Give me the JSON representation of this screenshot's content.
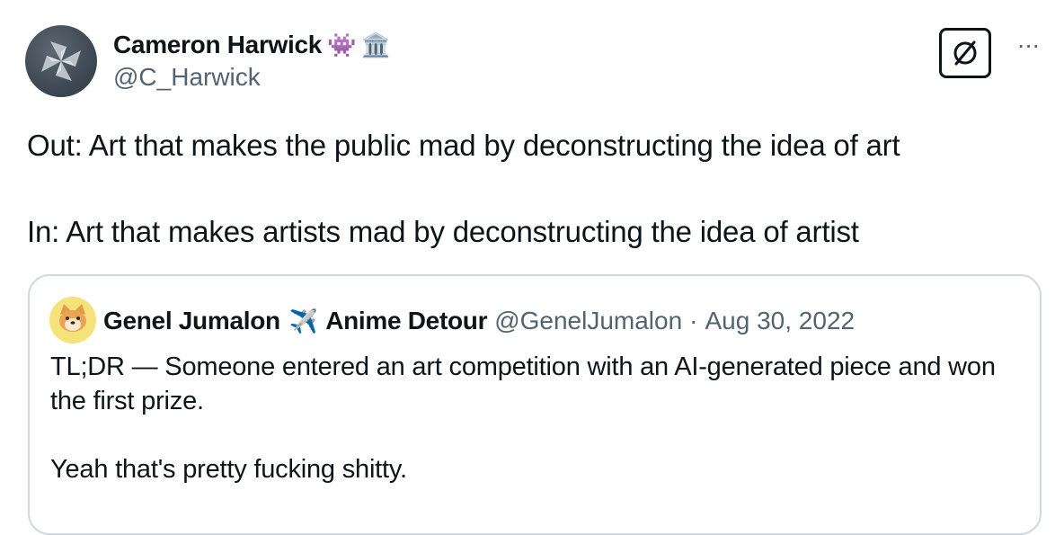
{
  "author": {
    "display_name": "Cameron Harwick",
    "emojis": [
      "👾",
      "🏛️"
    ],
    "handle": "@C_Harwick"
  },
  "header_actions": {
    "grok_icon": "slashed-circle-icon",
    "more_label": "···"
  },
  "tweet": {
    "line1": "Out: Art that makes the public mad by deconstructing the idea of art",
    "line2": "In: Art that makes artists mad by deconstructing the idea of artist"
  },
  "quoted": {
    "display_name_part1": "Genel Jumalon",
    "plane_emoji": "✈️",
    "display_name_part2": "Anime Detour",
    "handle": "@GenelJumalon",
    "separator": "·",
    "date": "Aug 30, 2022",
    "line1": "TL;DR — Someone entered an art competition with an AI-generated piece and won the first prize.",
    "line2": "Yeah that's pretty fucking shitty."
  },
  "colors": {
    "text_primary": "#0f1419",
    "text_secondary": "#536471",
    "border": "#cfd9de",
    "quoted_avatar_bg": "#f6e27a"
  }
}
